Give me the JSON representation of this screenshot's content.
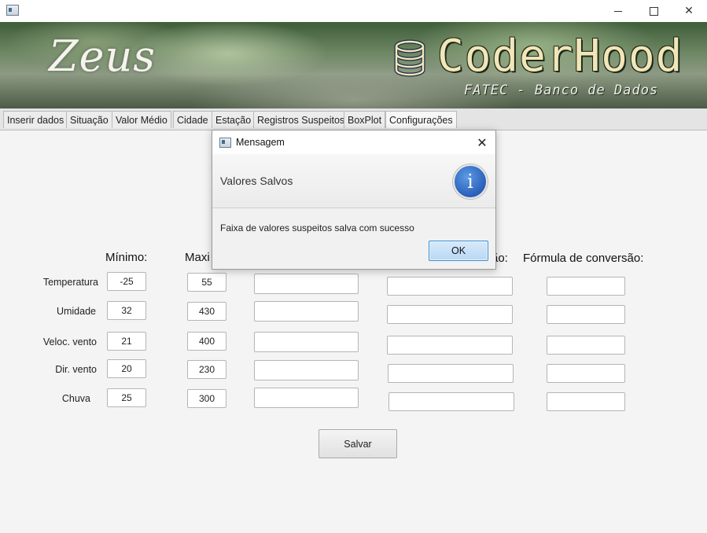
{
  "window": {
    "minimize_glyph": "—",
    "close_glyph": "✕"
  },
  "banner": {
    "left_title": "Zeus",
    "brand": "CoderHood",
    "subtitle": "FATEC - Banco de Dados"
  },
  "tabs": [
    {
      "label": "Inserir dados"
    },
    {
      "label": "Situação"
    },
    {
      "label": "Valor Médio"
    },
    {
      "label": "Cidade"
    },
    {
      "label": "Estação"
    },
    {
      "label": "Registros Suspeitos"
    },
    {
      "label": "BoxPlot"
    },
    {
      "label": "Configurações"
    }
  ],
  "form": {
    "headers": {
      "min": "Mínimo:",
      "max": "Maxi",
      "col4_partial": "ão:",
      "formula": "Fórmula de conversão:"
    },
    "rows": [
      {
        "label": "Temperatura",
        "min": "-25",
        "max": "55"
      },
      {
        "label": "Umidade",
        "min": "32",
        "max": "430"
      },
      {
        "label": "Veloc. vento",
        "min": "21",
        "max": "400"
      },
      {
        "label": "Dir. vento",
        "min": "20",
        "max": "230"
      },
      {
        "label": "Chuva",
        "min": "25",
        "max": "300"
      }
    ],
    "save_label": "Salvar"
  },
  "dialog": {
    "title": "Mensagem",
    "close_glyph": "✕",
    "heading": "Valores Salvos",
    "info_glyph": "i",
    "message": "Faixa de valores suspeitos salva com sucesso",
    "ok_label": "OK"
  }
}
